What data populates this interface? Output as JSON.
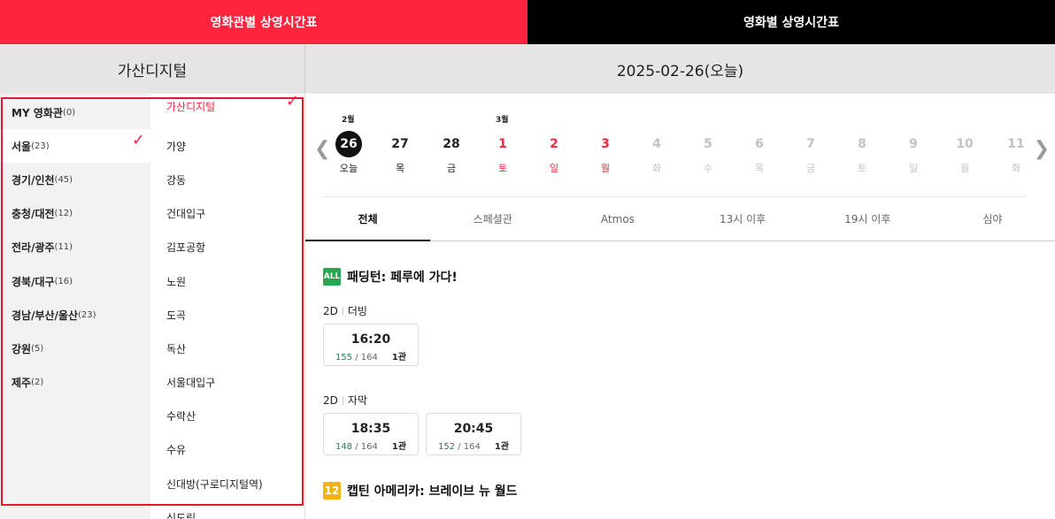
{
  "top_tabs": [
    "영화관별 상영시간표",
    "영화별 상영시간표"
  ],
  "header": {
    "cinema": "가산디지털",
    "date": "2025-02-26(오늘)"
  },
  "regions": [
    {
      "name": "MY 영화관",
      "count": "(0)"
    },
    {
      "name": "서울",
      "count": "(23)"
    },
    {
      "name": "경기/인천",
      "count": "(45)"
    },
    {
      "name": "충청/대전",
      "count": "(12)"
    },
    {
      "name": "전라/광주",
      "count": "(11)"
    },
    {
      "name": "경북/대구",
      "count": "(16)"
    },
    {
      "name": "경남/부산/울산",
      "count": "(23)"
    },
    {
      "name": "강원",
      "count": "(5)"
    },
    {
      "name": "제주",
      "count": "(2)"
    }
  ],
  "selected_region": "서울",
  "cinemas": [
    "가산디지털",
    "가양",
    "강동",
    "건대입구",
    "김포공항",
    "노원",
    "도곡",
    "독산",
    "서울대입구",
    "수락산",
    "수유",
    "신대방(구로디지털역)",
    "신도림"
  ],
  "selected_cinema": "가산디지털",
  "months": [
    "2월",
    "3월"
  ],
  "days": [
    {
      "num": "26",
      "wd": "오늘",
      "state": "today"
    },
    {
      "num": "27",
      "wd": "목",
      "state": "normal"
    },
    {
      "num": "28",
      "wd": "금",
      "state": "normal"
    },
    {
      "num": "1",
      "wd": "토",
      "state": "red"
    },
    {
      "num": "2",
      "wd": "일",
      "state": "red"
    },
    {
      "num": "3",
      "wd": "월",
      "state": "red"
    },
    {
      "num": "4",
      "wd": "화",
      "state": "dim"
    },
    {
      "num": "5",
      "wd": "수",
      "state": "dim"
    },
    {
      "num": "6",
      "wd": "목",
      "state": "dim"
    },
    {
      "num": "7",
      "wd": "금",
      "state": "dim"
    },
    {
      "num": "8",
      "wd": "토",
      "state": "dim"
    },
    {
      "num": "9",
      "wd": "일",
      "state": "dim"
    },
    {
      "num": "10",
      "wd": "월",
      "state": "dim"
    },
    {
      "num": "11",
      "wd": "화",
      "state": "dim"
    }
  ],
  "filters": [
    "전체",
    "스페셜관",
    "Atmos",
    "13시 이후",
    "19시 이후",
    "심야"
  ],
  "movies": [
    {
      "rating": "ALL",
      "title": "패딩턴: 페루에 가다!",
      "groups": [
        {
          "dim": "2D",
          "lang": "더빙",
          "times": [
            {
              "time": "16:20",
              "seats": "155",
              "total": " / 164",
              "hall": "1관"
            }
          ]
        },
        {
          "dim": "2D",
          "lang": "자막",
          "times": [
            {
              "time": "18:35",
              "seats": "148",
              "total": " / 164",
              "hall": "1관"
            },
            {
              "time": "20:45",
              "seats": "152",
              "total": " / 164",
              "hall": "1관"
            }
          ]
        }
      ]
    },
    {
      "rating": "12",
      "title": "캡틴 아메리카: 브레이브 뉴 월드",
      "groups": []
    }
  ]
}
